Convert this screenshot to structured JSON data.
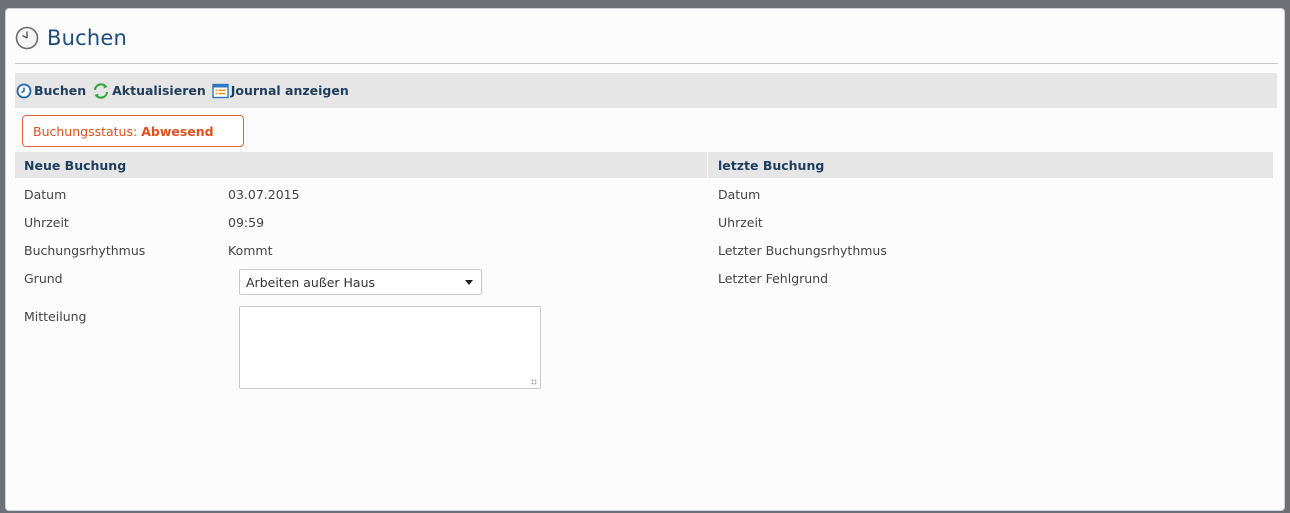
{
  "page": {
    "title": "Buchen"
  },
  "toolbar": {
    "buchen": "Buchen",
    "aktualisieren": "Aktualisieren",
    "journal": "Journal anzeigen"
  },
  "status": {
    "label": "Buchungsstatus:",
    "value": "Abwesend",
    "color": "#e0501e"
  },
  "neue_buchung": {
    "heading": "Neue Buchung",
    "datum_label": "Datum",
    "datum_value": "03.07.2015",
    "uhrzeit_label": "Uhrzeit",
    "uhrzeit_value": "09:59",
    "rhythmus_label": "Buchungsrhythmus",
    "rhythmus_value": "Kommt",
    "grund_label": "Grund",
    "grund_value": "Arbeiten außer Haus",
    "mitteilung_label": "Mitteilung",
    "mitteilung_value": ""
  },
  "letzte_buchung": {
    "heading": "letzte Buchung",
    "datum_label": "Datum",
    "uhrzeit_label": "Uhrzeit",
    "rhythmus_label": "Letzter Buchungsrhythmus",
    "fehlgrund_label": "Letzter Fehlgrund"
  },
  "icons": {
    "title": "clock-icon",
    "buchen": "clock-arrow-icon",
    "aktualisieren": "refresh-icon",
    "journal": "journal-list-icon"
  },
  "colors": {
    "header_blue": "#1f4b7a",
    "toolbar_bg": "#e6e6e6",
    "status_border": "#e0653b"
  }
}
